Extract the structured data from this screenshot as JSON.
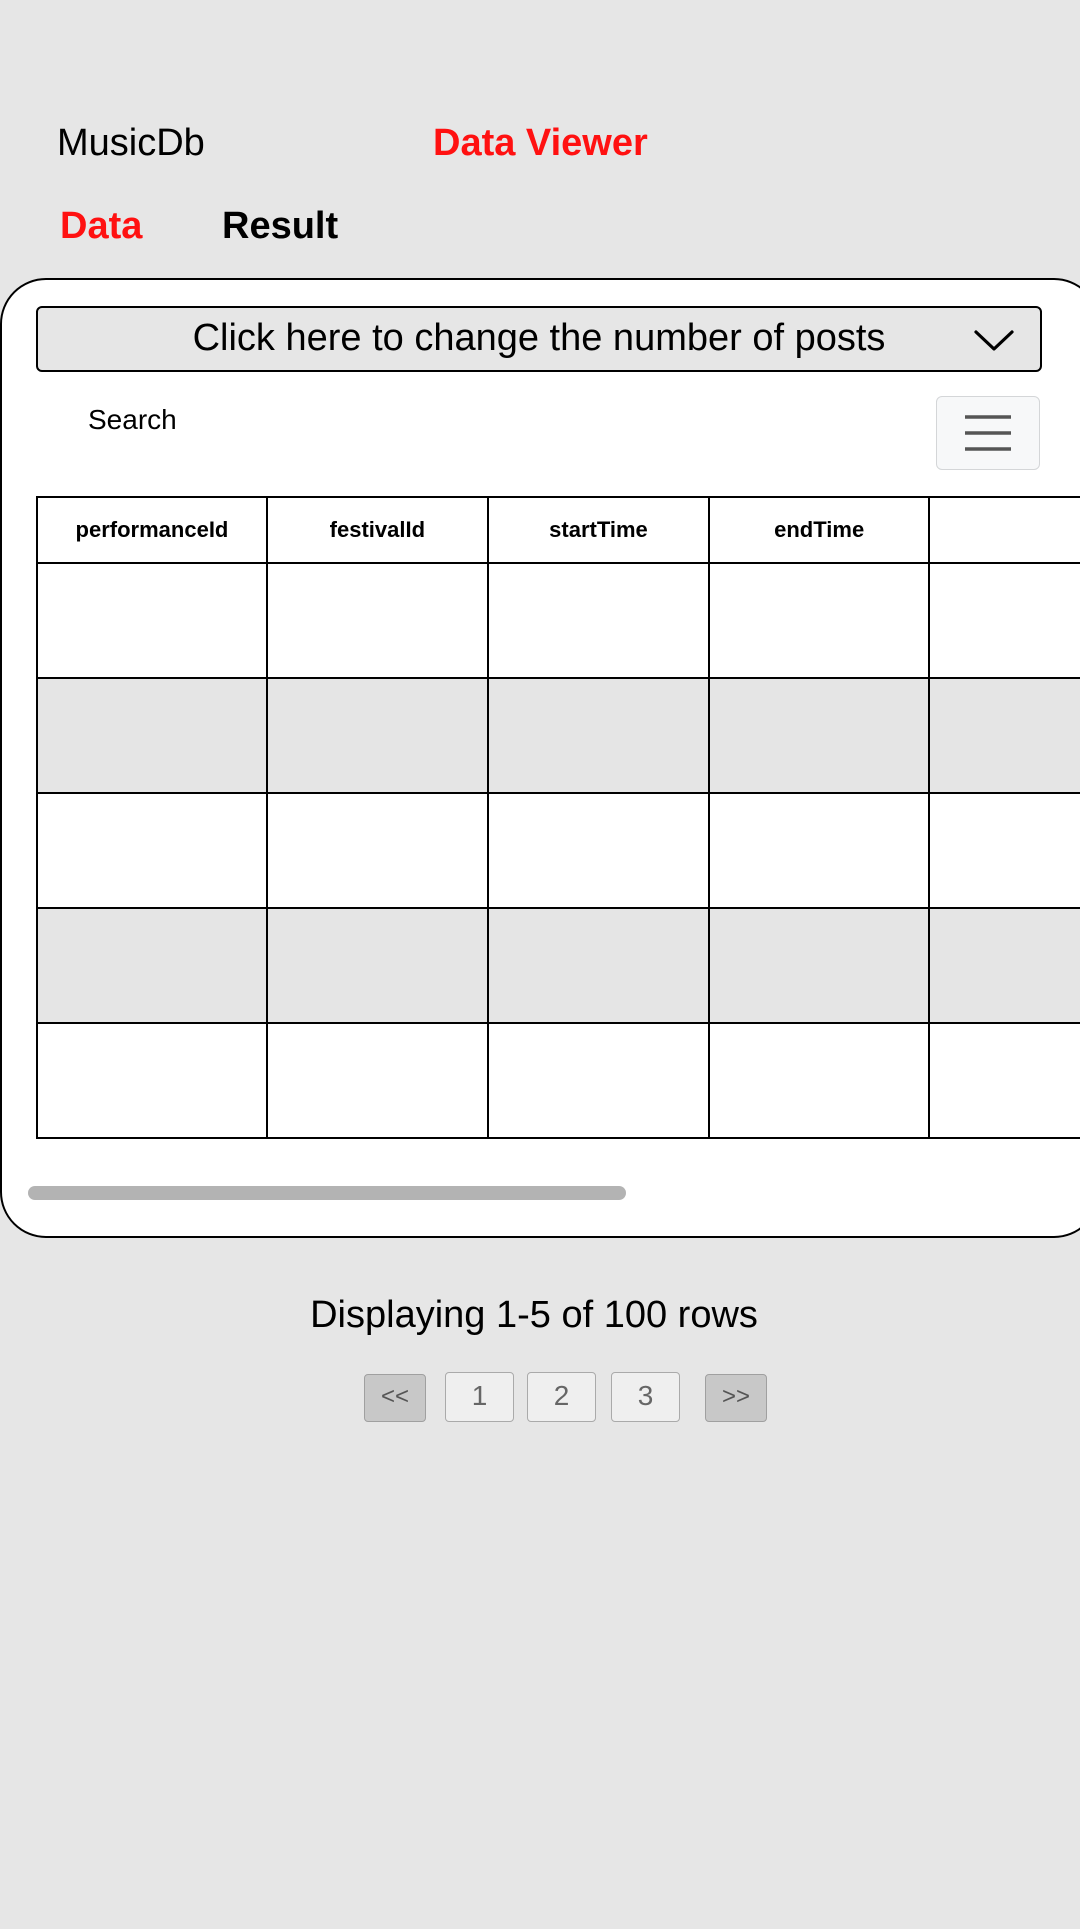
{
  "header": {
    "app_title": "MusicDb",
    "viewer_title": "Data Viewer"
  },
  "tabs": [
    {
      "label": "Data",
      "active": true
    },
    {
      "label": "Result",
      "active": false
    }
  ],
  "colors": {
    "accent": "#ff1111",
    "background": "#e6e6e6",
    "panel": "#ffffff",
    "stripe": "#e5e5e5"
  },
  "controls": {
    "posts_dropdown_label": "Click here to change the number of posts",
    "dropdown_icon": "chevron-down-icon",
    "search_label": "Search",
    "menu_icon": "hamburger-menu-icon"
  },
  "table": {
    "columns": [
      "performanceId",
      "festivalId",
      "startTime",
      "endTime",
      ""
    ],
    "rows": [
      [
        "",
        "",
        "",
        "",
        ""
      ],
      [
        "",
        "",
        "",
        "",
        ""
      ],
      [
        "",
        "",
        "",
        "",
        ""
      ],
      [
        "",
        "",
        "",
        "",
        ""
      ],
      [
        "",
        "",
        "",
        "",
        ""
      ]
    ]
  },
  "footer": {
    "row_count_text": "Displaying 1-5 of 100 rows",
    "pagination": {
      "first": "<<",
      "pages": [
        "1",
        "2",
        "3"
      ],
      "last": ">>"
    }
  }
}
